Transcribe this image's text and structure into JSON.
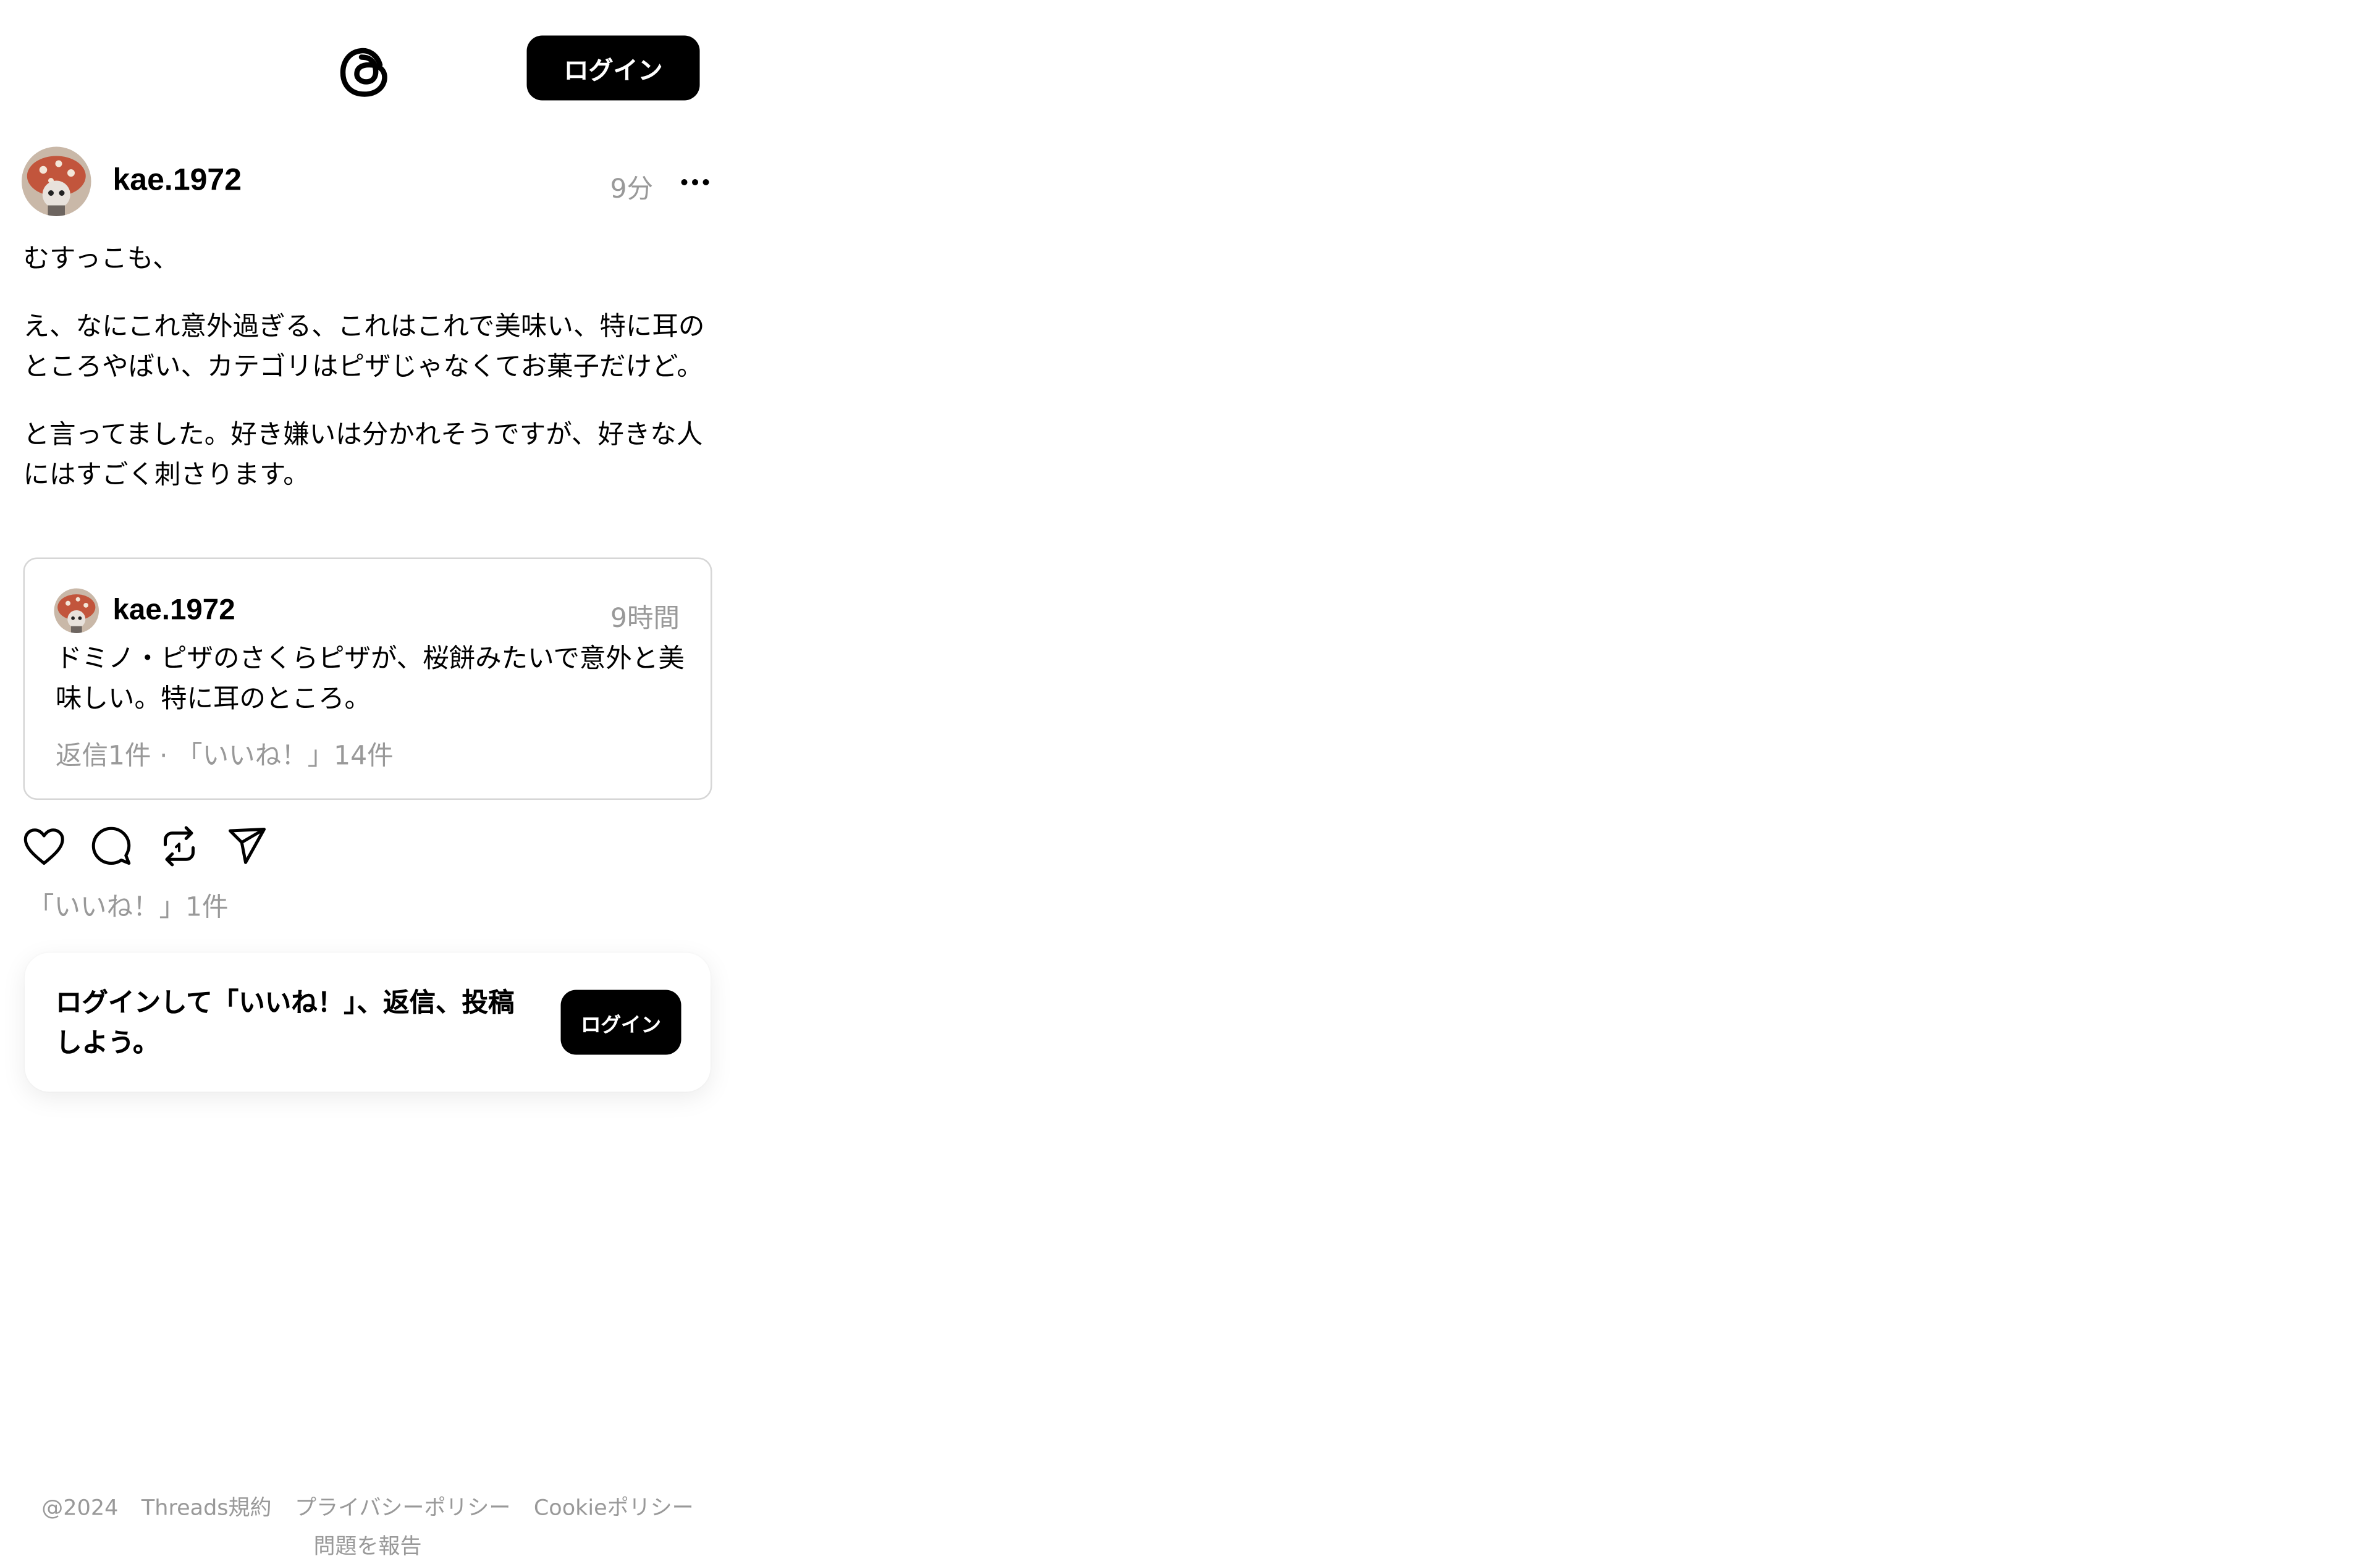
{
  "header": {
    "logo": "threads-logo-icon",
    "login_label": "ログイン"
  },
  "post": {
    "username": "kae.1972",
    "time": "9分",
    "more_icon": "more-dots-icon",
    "paragraphs": [
      "むすっこも、",
      "え、なにこれ意外過ぎる、これはこれで美味い、特に耳のところやばい、カテゴリはピザじゃなくてお菓子だけど。",
      "と言ってました。好き嫌いは分かれそうですが、好きな人にはすごく刺さります。"
    ],
    "quoted": {
      "username": "kae.1972",
      "time": "9時間",
      "text": "ドミノ・ピザのさくらピザが、桜餅みたいで意外と美味しい。特に耳のところ。",
      "meta": "返信1件 · 「いいね！」14件"
    },
    "actions": [
      "heart-icon",
      "comment-icon",
      "repost-icon",
      "share-icon"
    ],
    "likes": "「いいね！」1件"
  },
  "login_prompt": {
    "text": "ログインして「いいね！」、返信、投稿しよう。",
    "button_label": "ログイン"
  },
  "footer": {
    "links": [
      "@2024",
      "Threads規約",
      "プライバシーポリシー",
      "Cookieポリシー"
    ],
    "report": "問題を報告"
  }
}
